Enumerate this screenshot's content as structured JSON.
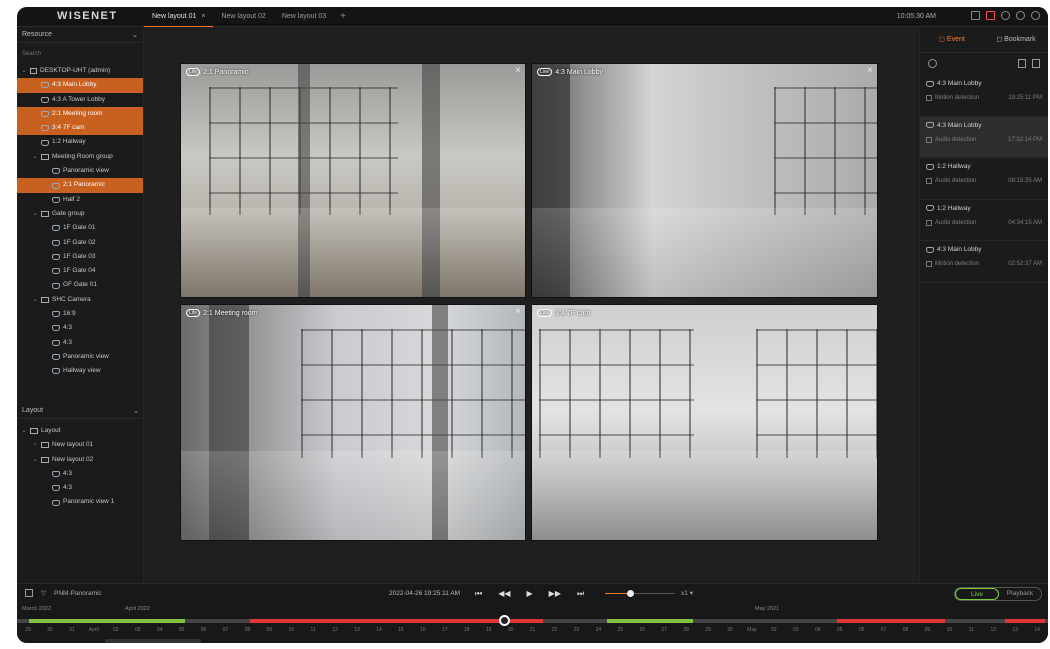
{
  "app": {
    "logo": "WISENET",
    "clock": "10:05:30 AM"
  },
  "tabs": [
    {
      "label": "New layout 01",
      "close": "×"
    },
    {
      "label": "New layout 02"
    },
    {
      "label": "New layout 03"
    }
  ],
  "tab_add": "+",
  "resource": {
    "header": "Resource",
    "search_placeholder": "Search",
    "items": [
      {
        "label": "DESKTOP-UHT (admin)",
        "level": 0,
        "kind": "pc",
        "caret": "⌄"
      },
      {
        "label": "4:3 Main Lobby",
        "level": 1,
        "kind": "cam",
        "selected": true
      },
      {
        "label": "4:3 A Tower Lobby",
        "level": 1,
        "kind": "cam"
      },
      {
        "label": "2:1 Meeting room",
        "level": 1,
        "kind": "cam",
        "selected": true
      },
      {
        "label": "3:4 7F cam",
        "level": 1,
        "kind": "cam",
        "selected": true
      },
      {
        "label": "1:2 Hallway",
        "level": 1,
        "kind": "cam"
      },
      {
        "label": "Meeting Room group",
        "level": 1,
        "kind": "folder",
        "caret": "⌄"
      },
      {
        "label": "Panoramic view",
        "level": 2,
        "kind": "cam"
      },
      {
        "label": "2:1 Panoramic",
        "level": 2,
        "kind": "cam",
        "selected": true
      },
      {
        "label": "Half 2",
        "level": 2,
        "kind": "cam"
      },
      {
        "label": "Gate group",
        "level": 1,
        "kind": "folder",
        "caret": "⌄"
      },
      {
        "label": "1F Gate 01",
        "level": 2,
        "kind": "cam"
      },
      {
        "label": "1F Gate 02",
        "level": 2,
        "kind": "cam"
      },
      {
        "label": "1F Gate 03",
        "level": 2,
        "kind": "cam"
      },
      {
        "label": "1F Gate 04",
        "level": 2,
        "kind": "cam"
      },
      {
        "label": "GF Gate 01",
        "level": 2,
        "kind": "cam"
      },
      {
        "label": "SHC Camera",
        "level": 1,
        "kind": "folder",
        "caret": "⌄"
      },
      {
        "label": "16:9",
        "level": 2,
        "kind": "cam"
      },
      {
        "label": "4:3",
        "level": 2,
        "kind": "cam"
      },
      {
        "label": "4:3",
        "level": 2,
        "kind": "cam"
      },
      {
        "label": "Panoramic view",
        "level": 2,
        "kind": "cam"
      },
      {
        "label": "Hallway view",
        "level": 2,
        "kind": "cam"
      }
    ]
  },
  "layout_panel": {
    "header": "Layout",
    "items": [
      {
        "label": "Layout",
        "level": 0,
        "kind": "folder",
        "caret": "⌄"
      },
      {
        "label": "New layout 01",
        "level": 1,
        "kind": "folder",
        "caret": "›"
      },
      {
        "label": "New layout 02",
        "level": 1,
        "kind": "folder",
        "caret": "⌄"
      },
      {
        "label": "4:3",
        "level": 2,
        "kind": "cam"
      },
      {
        "label": "4:3",
        "level": 2,
        "kind": "cam"
      },
      {
        "label": "Panoramic view 1",
        "level": 2,
        "kind": "cam"
      }
    ]
  },
  "tiles": [
    {
      "badge": "Life",
      "label": "2:1 Panoramic"
    },
    {
      "badge": "Live",
      "label": "4:3 Main Lobby"
    },
    {
      "badge": "Life",
      "label": "2:1 Meeting room"
    },
    {
      "badge": "Live",
      "label": "3:4 7F cam"
    }
  ],
  "right_panel": {
    "tab_event": "Event",
    "tab_bookmark": "Bookmark",
    "events": [
      {
        "camera": "4:3 Main Lobby",
        "type": "Motion detection",
        "time": "19:25:11 PM",
        "selected": false
      },
      {
        "camera": "4:3 Main Lobby",
        "type": "Audio detection",
        "time": "17:32:14 PM",
        "selected": true
      },
      {
        "camera": "1:2 Hallway",
        "type": "Audio detection",
        "time": "08:15:35 AM",
        "selected": false
      },
      {
        "camera": "1:2 Hallway",
        "type": "Audio detection",
        "time": "04:34:15 AM",
        "selected": false
      },
      {
        "camera": "4:3 Main Lobby",
        "type": "Motion detection",
        "time": "02:52:37 AM",
        "selected": false
      }
    ]
  },
  "playback": {
    "channel": "PNM-Panoramic",
    "datetime": "2022-04-26 19:25:11 AM",
    "buttons": [
      "⏮",
      "◀◀",
      "▶",
      "▶▶",
      "⏭"
    ],
    "speed": "x1",
    "speed_level": 0.35,
    "mode_live": "Live",
    "mode_playback": "Playback",
    "months": [
      "March 2022",
      "April 2022",
      "May 2021"
    ],
    "days": [
      "29",
      "30",
      "31",
      "April",
      "02",
      "03",
      "04",
      "05",
      "06",
      "07",
      "08",
      "09",
      "10",
      "11",
      "12",
      "13",
      "14",
      "15",
      "16",
      "17",
      "18",
      "19",
      "20",
      "21",
      "22",
      "23",
      "24",
      "25",
      "26",
      "27",
      "28",
      "29",
      "30",
      "May",
      "02",
      "03",
      "04",
      "05",
      "06",
      "07",
      "08",
      "09",
      "10",
      "11",
      "12",
      "13",
      "14"
    ]
  },
  "colors": {
    "accent": "#ff7a2a",
    "selected_row": "#c8601f",
    "live_green": "#7dcf3a",
    "timeline_green": "#84c241",
    "timeline_red": "#e23535"
  }
}
